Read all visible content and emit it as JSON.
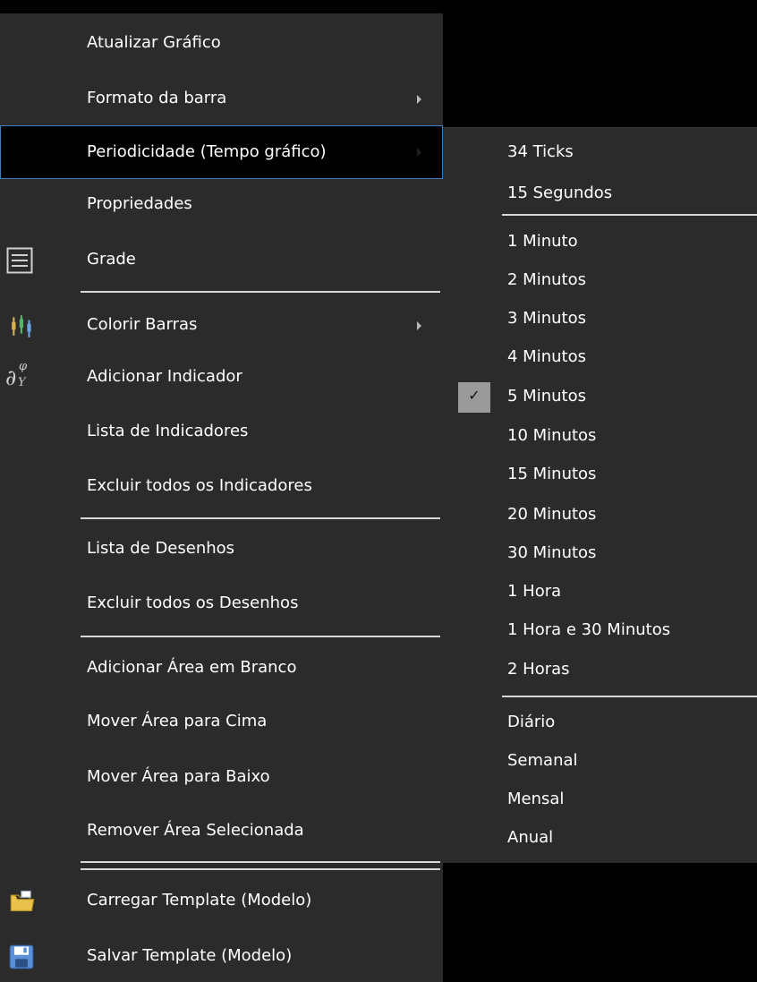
{
  "main_menu": {
    "items": [
      {
        "label": "Atualizar Gráfico"
      },
      {
        "label": "Formato da barra"
      },
      {
        "label": "Periodicidade (Tempo gráfico)"
      },
      {
        "label": "Propriedades"
      },
      {
        "label": "Grade",
        "icon": "grid-list-icon"
      },
      {
        "label": "Colorir Barras",
        "icon": "color-bars-icon"
      },
      {
        "label": "Adicionar Indicador",
        "icon": "indicator-formula-icon",
        "icon_text": "∂",
        "icon_sub": "Y",
        "icon_sup": "φ"
      },
      {
        "label": "Lista de Indicadores"
      },
      {
        "label": "Excluir todos os Indicadores"
      },
      {
        "label": "Lista de Desenhos"
      },
      {
        "label": "Excluir todos os Desenhos"
      },
      {
        "label": "Adicionar Área em Branco"
      },
      {
        "label": "Mover Área para Cima"
      },
      {
        "label": "Mover Área para Baixo"
      },
      {
        "label": "Remover Área Selecionada"
      },
      {
        "label": "Carregar Template (Modelo)",
        "icon": "folder-open-icon"
      },
      {
        "label": "Salvar Template (Modelo)",
        "icon": "floppy-disk-icon"
      }
    ],
    "highlighted_item": "Periodicidade (Tempo gráfico)"
  },
  "submenu": {
    "title_of_parent": "Periodicidade (Tempo gráfico)",
    "items": [
      {
        "label": "34 Ticks"
      },
      {
        "label": "15 Segundos"
      },
      {
        "label": "1 Minuto"
      },
      {
        "label": "2 Minutos"
      },
      {
        "label": "3 Minutos"
      },
      {
        "label": "4 Minutos"
      },
      {
        "label": "5 Minutos",
        "checked": true
      },
      {
        "label": "10 Minutos"
      },
      {
        "label": "15 Minutos"
      },
      {
        "label": "20 Minutos"
      },
      {
        "label": "30 Minutos"
      },
      {
        "label": "1 Hora"
      },
      {
        "label": "1 Hora e 30 Minutos"
      },
      {
        "label": "2 Horas"
      },
      {
        "label": "Diário"
      },
      {
        "label": "Semanal"
      },
      {
        "label": "Mensal"
      },
      {
        "label": "Anual"
      }
    ],
    "check_mark": "✓"
  },
  "colors": {
    "menu_bg": "#2b2b2b",
    "highlight_bg": "#000000",
    "highlight_border": "#3a7fc4",
    "separator": "#d8d8d8",
    "check_bg": "#9a9a9a"
  }
}
